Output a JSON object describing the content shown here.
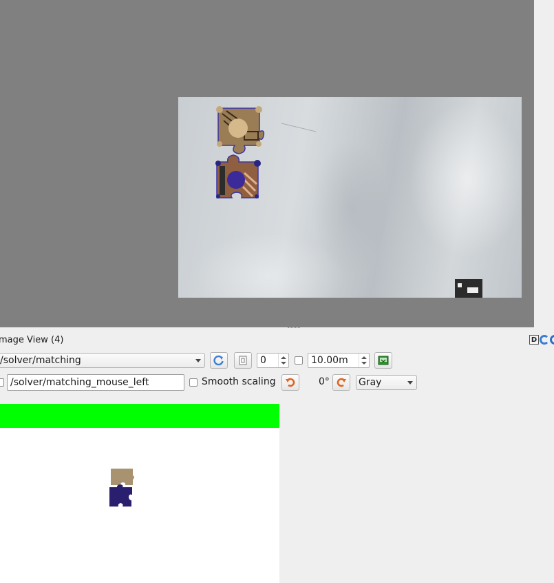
{
  "panel": {
    "title": "mage View (4)",
    "dock_d_label": "D"
  },
  "toolbar1": {
    "topic": "/solver/matching",
    "spin_value": "0",
    "distance_value": "10.00m"
  },
  "toolbar2": {
    "mouse_topic": "/solver/matching_mouse_left",
    "smooth_scaling_label": "Smooth scaling",
    "smooth_scaling_checked": false,
    "rotation_label": "0°",
    "colormap": "Gray"
  },
  "colors": {
    "piece_tan": "#a89270",
    "piece_blue": "#2a1f6e",
    "match_indicator": "#00ff00",
    "view_background": "#808080"
  },
  "icons": {
    "refresh": "refresh-icon",
    "save": "save-image-icon",
    "rotate_left": "rotate-left-icon",
    "rotate_right": "rotate-right-icon"
  }
}
